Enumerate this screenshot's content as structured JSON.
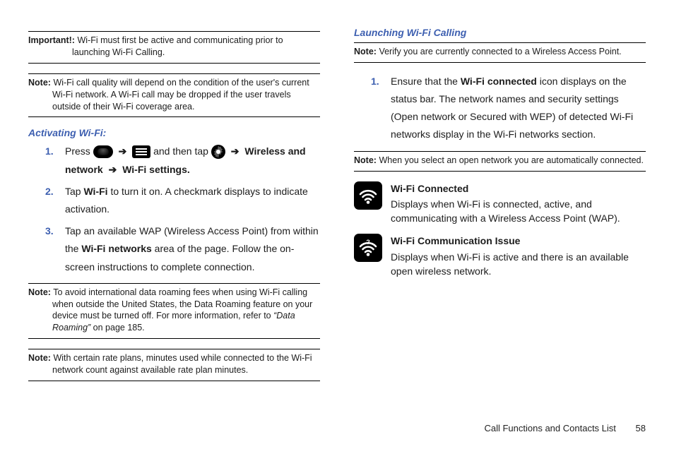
{
  "left": {
    "important": {
      "label": "Important!:",
      "text": "Wi-Fi must first be active and communicating prior to launching Wi-Fi Calling."
    },
    "note_quality": {
      "label": "Note:",
      "text": "Wi-Fi call quality will depend on the condition of the user's current Wi-Fi network. A Wi-Fi call may be dropped if the user travels outside of their Wi-Fi coverage area."
    },
    "heading": "Activating Wi-Fi:",
    "steps": {
      "s1_press": "Press ",
      "s1_andthentap": " and then tap ",
      "s1_tail_bold": "Wireless and network",
      "s1_tail_bold2": "Wi-Fi settings.",
      "s2_a": "Tap ",
      "s2_b": "Wi-Fi",
      "s2_c": " to turn it on. A checkmark displays to indicate activation.",
      "s3_a": "Tap an available WAP (Wireless Access Point) from within the ",
      "s3_b": "Wi-Fi networks",
      "s3_c": " area of the page. Follow the on-screen instructions to complete connection."
    },
    "note_roaming": {
      "label": "Note:",
      "text_a": "To avoid international data roaming fees when using Wi-Fi calling when outside the United States, the Data Roaming feature on your device must be turned off. For more information, refer to ",
      "text_i": "“Data Roaming”",
      "text_b": "  on page 185."
    },
    "note_minutes": {
      "label": "Note:",
      "text": "With certain rate plans, minutes used while connected to the Wi-Fi network count against available rate plan minutes."
    }
  },
  "right": {
    "heading": "Launching Wi-Fi Calling",
    "note_verify": {
      "label": "Note:",
      "text": "Verify you are currently connected to a Wireless Access Point."
    },
    "steps": {
      "s1_a": "Ensure that the ",
      "s1_b": "Wi-Fi connected",
      "s1_c": " icon displays on the status bar. The network names and security settings (Open network or Secured with WEP) of detected Wi-Fi networks display in the Wi-Fi networks section."
    },
    "note_open": {
      "label": "Note:",
      "text": "When you select an open network you are automatically connected."
    },
    "status_connected": {
      "title": "Wi-Fi Connected",
      "desc": "Displays when Wi-Fi is connected, active, and communicating with a Wireless Access Point (WAP)."
    },
    "status_issue": {
      "title": "Wi-Fi Communication Issue",
      "desc": "Displays when Wi-Fi is active and there is an available open wireless network."
    }
  },
  "footer": {
    "section": "Call Functions and Contacts List",
    "page": "58"
  },
  "glyphs": {
    "arrow": "➔"
  }
}
